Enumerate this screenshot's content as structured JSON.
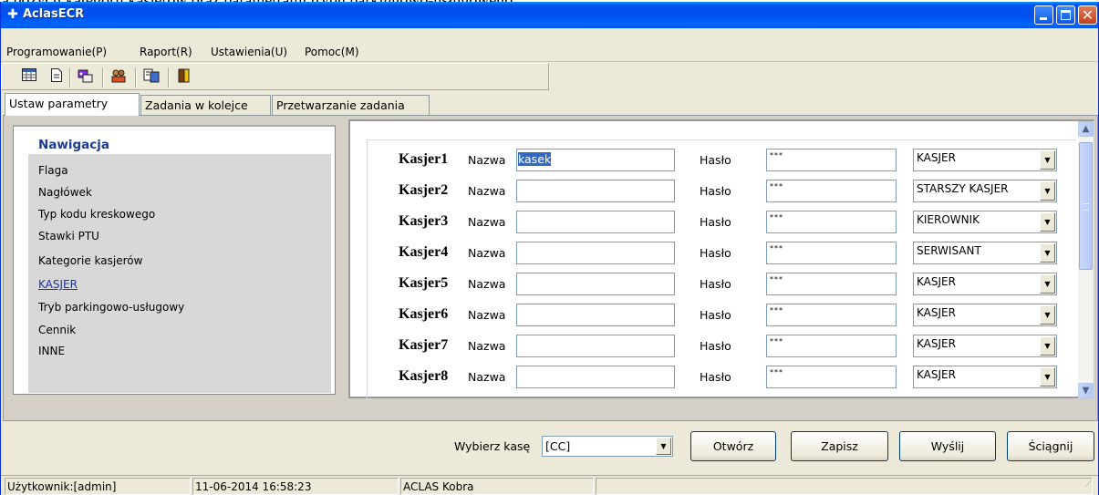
{
  "window": {
    "title": "AclasECR"
  },
  "menubar": {
    "items": [
      "Programowanie(P)",
      "Raport(R)",
      "Ustawienia(U)",
      "Pomoc(M)"
    ]
  },
  "toolbar": {
    "tools": [
      "table-icon",
      "document-icon",
      "cash-register-icon",
      "users-icon",
      "report-icon",
      "exit-door-icon"
    ]
  },
  "tabs": [
    "Ustaw parametry",
    "Zadania w kolejce",
    "Przetwarzanie zadania"
  ],
  "nav": {
    "header": "Nawigacja",
    "items": [
      "Flaga",
      "Nagłówek",
      "Typ kodu kreskowego",
      "Stawki PTU",
      "Kategorie kasjerów",
      "KASJER",
      "Tryb parkingowo-usługowy",
      "Cennik",
      "INNE"
    ]
  },
  "form": {
    "name_label": "Nazwa",
    "password_label": "Hasło",
    "rows": [
      {
        "label": "Kasjer1",
        "name": "kasek",
        "password": "***",
        "role": "KASJER"
      },
      {
        "label": "Kasjer2",
        "name": "",
        "password": "***",
        "role": "STARSZY KASJER"
      },
      {
        "label": "Kasjer3",
        "name": "",
        "password": "***",
        "role": "KIEROWNIK"
      },
      {
        "label": "Kasjer4",
        "name": "",
        "password": "***",
        "role": "SERWISANT"
      },
      {
        "label": "Kasjer5",
        "name": "",
        "password": "***",
        "role": "KASJER"
      },
      {
        "label": "Kasjer6",
        "name": "",
        "password": "***",
        "role": "KASJER"
      },
      {
        "label": "Kasjer7",
        "name": "",
        "password": "***",
        "role": "KASJER"
      },
      {
        "label": "Kasjer8",
        "name": "",
        "password": "***",
        "role": "KASJER"
      }
    ]
  },
  "bottom": {
    "register_label": "Wybierz kasę",
    "register_value": "[CC]",
    "buttons": [
      "Otwórz",
      "Zapisz",
      "Wyślij",
      "Ściągnij"
    ]
  },
  "status": {
    "user": "Użytkownik:[admin]",
    "datetime": "11-06-2014 16:58:23",
    "device": "ACLAS Kobra"
  },
  "colors": {
    "titlebar": "#0053ee",
    "link": "#1e32a8",
    "selection": "#316ac5"
  }
}
